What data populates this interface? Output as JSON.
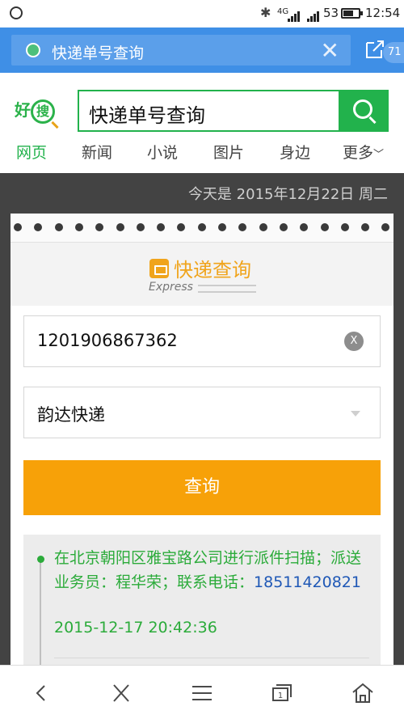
{
  "status_bar": {
    "network": "4G",
    "battery": "53",
    "time": "12:54"
  },
  "browser": {
    "url_title": "快递单号查询",
    "tab_count": "71"
  },
  "search": {
    "logo_text_a": "好",
    "logo_text_b": "搜",
    "query": "快递单号查询",
    "tabs": [
      {
        "label": "网页"
      },
      {
        "label": "新闻"
      },
      {
        "label": "小说"
      },
      {
        "label": "图片"
      },
      {
        "label": "身边"
      },
      {
        "label": "更多"
      }
    ]
  },
  "page": {
    "date": "今天是 2015年12月22日 周二",
    "brand_title": "快递查询",
    "brand_sub": "Express",
    "tracking_number": "1201906867362",
    "clear_label": "X",
    "company": "韵达快递",
    "query_button": "查询",
    "result": {
      "line1": "在北京朝阳区雅宝路公司进行派件扫描；派送业务员：程华荣；联系电话：",
      "phone": "18511420821",
      "time": "2015-12-17 20:42:36"
    }
  },
  "colors": {
    "accent_green": "#22b24c",
    "orange": "#f7a108",
    "url_bar_blue": "#3f8fe6"
  }
}
